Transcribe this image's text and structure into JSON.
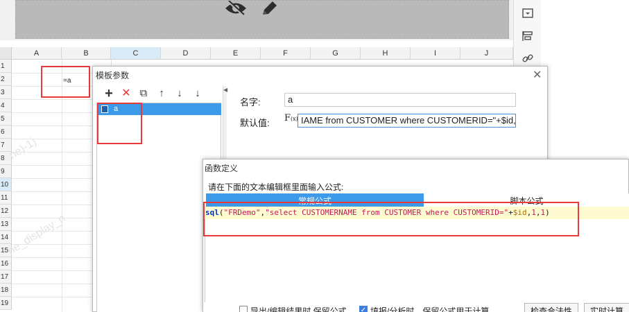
{
  "top_toolbar": {
    "icons": [
      "eye-slash-icon",
      "pencil-icon"
    ]
  },
  "right_sidebar": {
    "icons": [
      "panel-icon",
      "align-icon",
      "link-icon"
    ]
  },
  "sheet": {
    "columns": [
      "A",
      "B",
      "C",
      "D",
      "E",
      "F",
      "G",
      "H",
      "I",
      "J"
    ],
    "selected_column": "C",
    "rows": [
      "1",
      "2",
      "3",
      "4",
      "5",
      "6",
      "7",
      "8",
      "9",
      "10",
      "11",
      "12",
      "13",
      "14",
      "15",
      "16",
      "17",
      "18",
      "19"
    ],
    "selected_row": "10",
    "cell_b2": "=a",
    "watermarks": [
      "ne)-1)",
      "ne_display_n",
      "ne_display_n",
      "ne)-1)"
    ]
  },
  "template_dialog": {
    "title": "模板参数",
    "close_label": "✕",
    "toolbar": {
      "add": "+",
      "delete": "✕",
      "copy": "⧉",
      "up": "↑",
      "down": "↓",
      "sort": "↓"
    },
    "params": [
      {
        "name": "a"
      }
    ],
    "name_label": "名字:",
    "name_value": "a",
    "default_label": "默认值:",
    "fx_label": "F(x)",
    "default_value": "IAME from CUSTOMER where CUSTOMERID=\"+$id,1,1)"
  },
  "function_dialog": {
    "title": "函数定义",
    "hint": "请在下面的文本编辑框里面输入公式:",
    "tabs": [
      {
        "label": "常规公式",
        "active": true
      },
      {
        "label": "脚本公式",
        "active": false
      }
    ],
    "formula": {
      "fn": "sql",
      "open": "(",
      "arg1": "\"FRDemo\"",
      "comma1": ",",
      "arg2": "\"select CUSTOMERNAME from CUSTOMER where CUSTOMERID=\"",
      "plus": "+",
      "var": "$id",
      "comma2": ",",
      "n1": "1",
      "comma3": ",",
      "n2": "1",
      "close": ")"
    },
    "checkbox1_label": "导出/编辑结果时 保留公式",
    "checkbox1_checked": false,
    "checkbox2_label": "填报/分析时，保留公式用于计算",
    "checkbox2_checked": true,
    "btn_check": "检查合法性",
    "btn_calc": "实时计算"
  }
}
